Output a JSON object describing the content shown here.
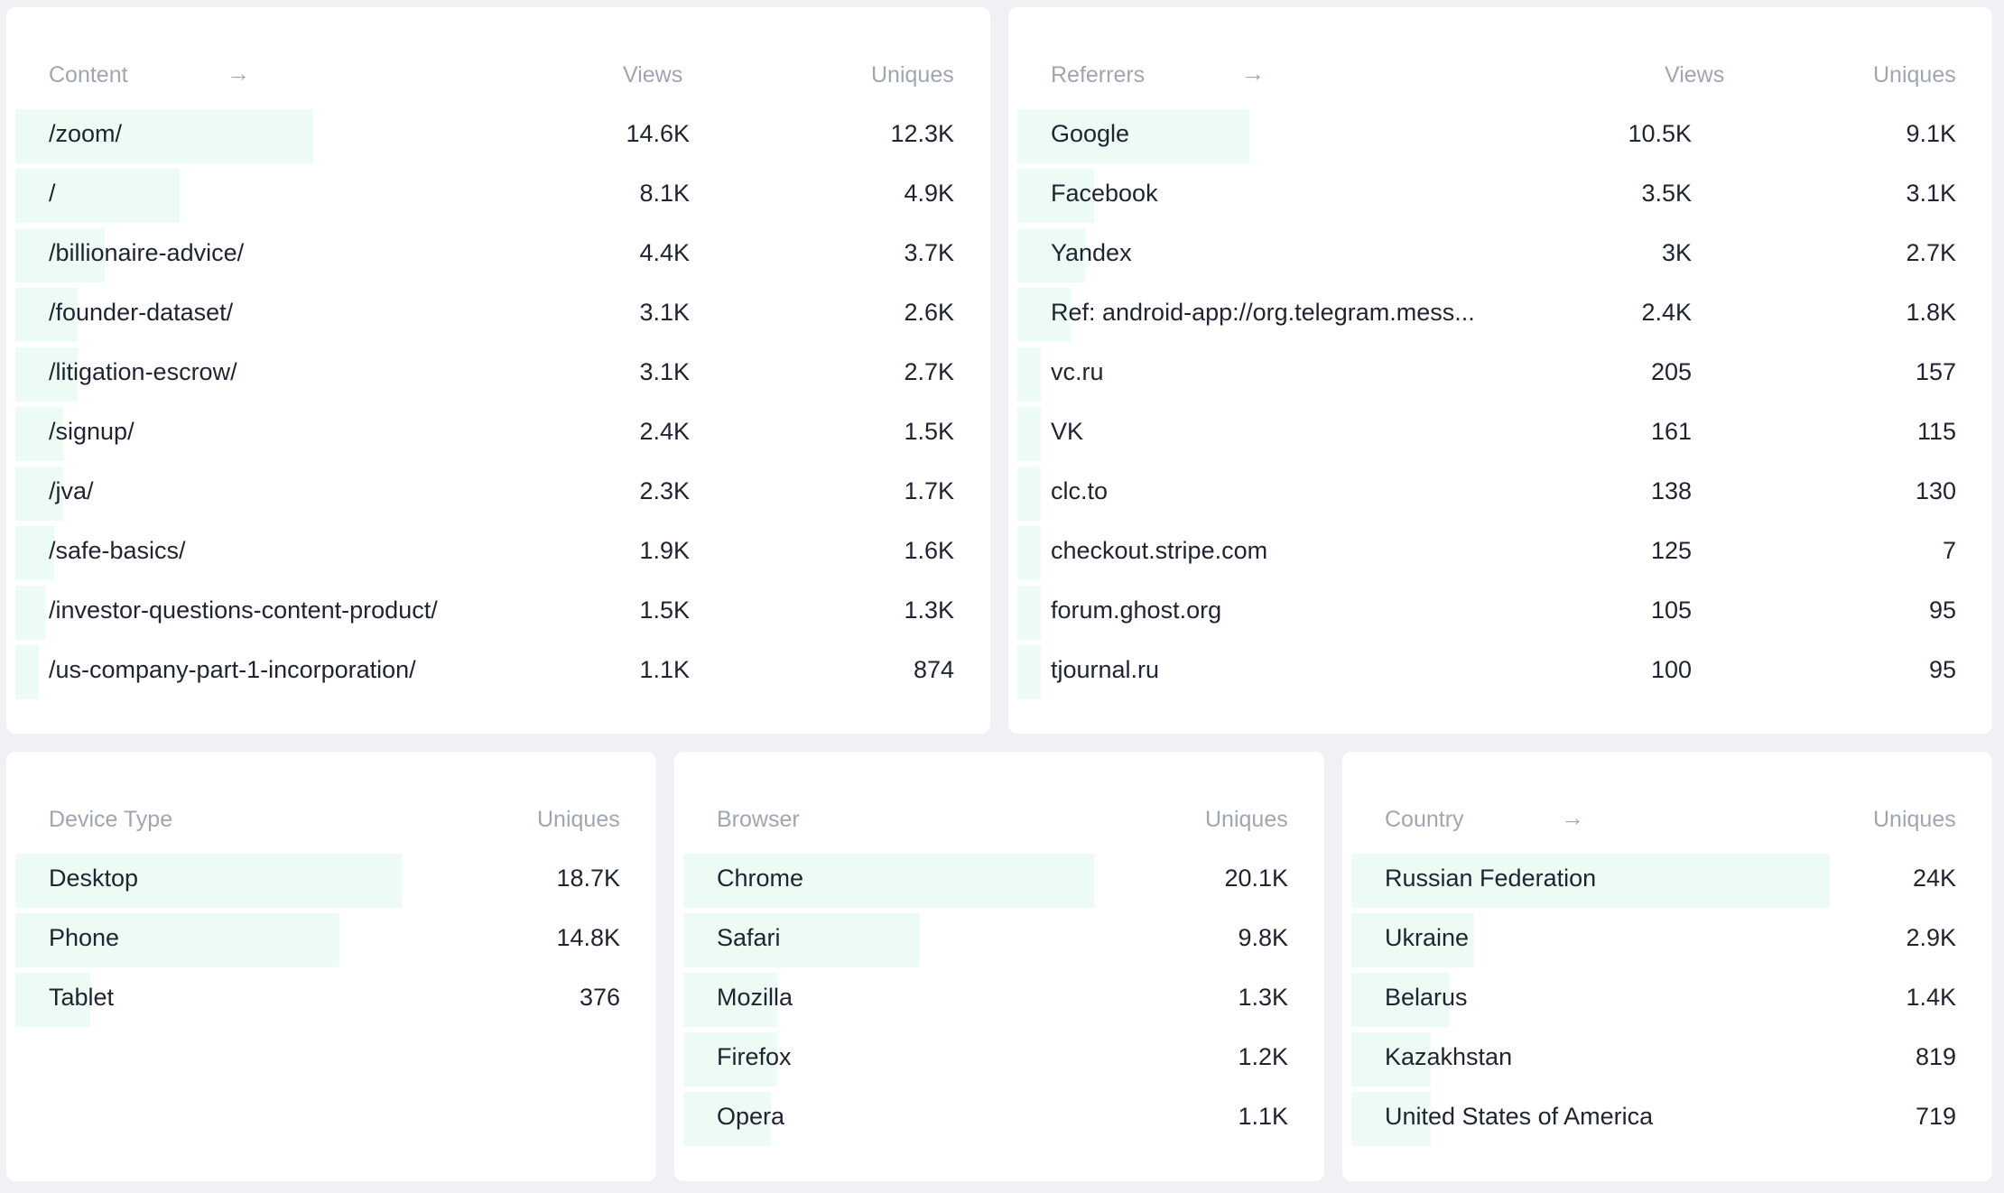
{
  "content": {
    "header": {
      "label": "Content",
      "views": "Views",
      "uniques": "Uniques"
    },
    "rows": [
      {
        "label": "/zoom/",
        "views": "14.6K",
        "uniques": "12.3K",
        "share": 1.0
      },
      {
        "label": "/",
        "views": "8.1K",
        "uniques": "4.9K",
        "share": 0.55
      },
      {
        "label": "/billionaire-advice/",
        "views": "4.4K",
        "uniques": "3.7K",
        "share": 0.3
      },
      {
        "label": "/founder-dataset/",
        "views": "3.1K",
        "uniques": "2.6K",
        "share": 0.21
      },
      {
        "label": "/litigation-escrow/",
        "views": "3.1K",
        "uniques": "2.7K",
        "share": 0.21
      },
      {
        "label": "/signup/",
        "views": "2.4K",
        "uniques": "1.5K",
        "share": 0.16
      },
      {
        "label": "/jva/",
        "views": "2.3K",
        "uniques": "1.7K",
        "share": 0.16
      },
      {
        "label": "/safe-basics/",
        "views": "1.9K",
        "uniques": "1.6K",
        "share": 0.13
      },
      {
        "label": "/investor-questions-content-product/",
        "views": "1.5K",
        "uniques": "1.3K",
        "share": 0.1
      },
      {
        "label": "/us-company-part-1-incorporation/",
        "views": "1.1K",
        "uniques": "874",
        "share": 0.08
      }
    ]
  },
  "referrers": {
    "header": {
      "label": "Referrers",
      "views": "Views",
      "uniques": "Uniques"
    },
    "rows": [
      {
        "label": "Google",
        "views": "10.5K",
        "uniques": "9.1K",
        "share": 1.0
      },
      {
        "label": "Facebook",
        "views": "3.5K",
        "uniques": "3.1K",
        "share": 0.33
      },
      {
        "label": "Yandex",
        "views": "3K",
        "uniques": "2.7K",
        "share": 0.29
      },
      {
        "label": "Ref: android-app://org.telegram.mess...",
        "views": "2.4K",
        "uniques": "1.8K",
        "share": 0.23
      },
      {
        "label": "vc.ru",
        "views": "205",
        "uniques": "157",
        "share": 0.1
      },
      {
        "label": "VK",
        "views": "161",
        "uniques": "115",
        "share": 0.1
      },
      {
        "label": "clc.to",
        "views": "138",
        "uniques": "130",
        "share": 0.1
      },
      {
        "label": "checkout.stripe.com",
        "views": "125",
        "uniques": "7",
        "share": 0.1
      },
      {
        "label": "forum.ghost.org",
        "views": "105",
        "uniques": "95",
        "share": 0.1
      },
      {
        "label": "tjournal.ru",
        "views": "100",
        "uniques": "95",
        "share": 0.1
      }
    ]
  },
  "device": {
    "header": {
      "label": "Device Type",
      "uniques": "Uniques"
    },
    "rows": [
      {
        "label": "Desktop",
        "uniques": "18.7K",
        "share": 0.62
      },
      {
        "label": "Phone",
        "uniques": "14.8K",
        "share": 0.52
      },
      {
        "label": "Tablet",
        "uniques": "376",
        "share": 0.12
      }
    ]
  },
  "browser": {
    "header": {
      "label": "Browser",
      "uniques": "Uniques"
    },
    "rows": [
      {
        "label": "Chrome",
        "uniques": "20.1K",
        "share": 0.66
      },
      {
        "label": "Safari",
        "uniques": "9.8K",
        "share": 0.38
      },
      {
        "label": "Mozilla",
        "uniques": "1.3K",
        "share": 0.15
      },
      {
        "label": "Firefox",
        "uniques": "1.2K",
        "share": 0.15
      },
      {
        "label": "Opera",
        "uniques": "1.1K",
        "share": 0.14
      }
    ]
  },
  "country": {
    "header": {
      "label": "Country",
      "uniques": "Uniques"
    },
    "rows": [
      {
        "label": "Russian Federation",
        "uniques": "24K",
        "share": 0.78
      },
      {
        "label": "Ukraine",
        "uniques": "2.9K",
        "share": 0.2
      },
      {
        "label": "Belarus",
        "uniques": "1.4K",
        "share": 0.16
      },
      {
        "label": "Kazakhstan",
        "uniques": "819",
        "share": 0.13
      },
      {
        "label": "United States of America",
        "uniques": "719",
        "share": 0.13
      }
    ]
  }
}
